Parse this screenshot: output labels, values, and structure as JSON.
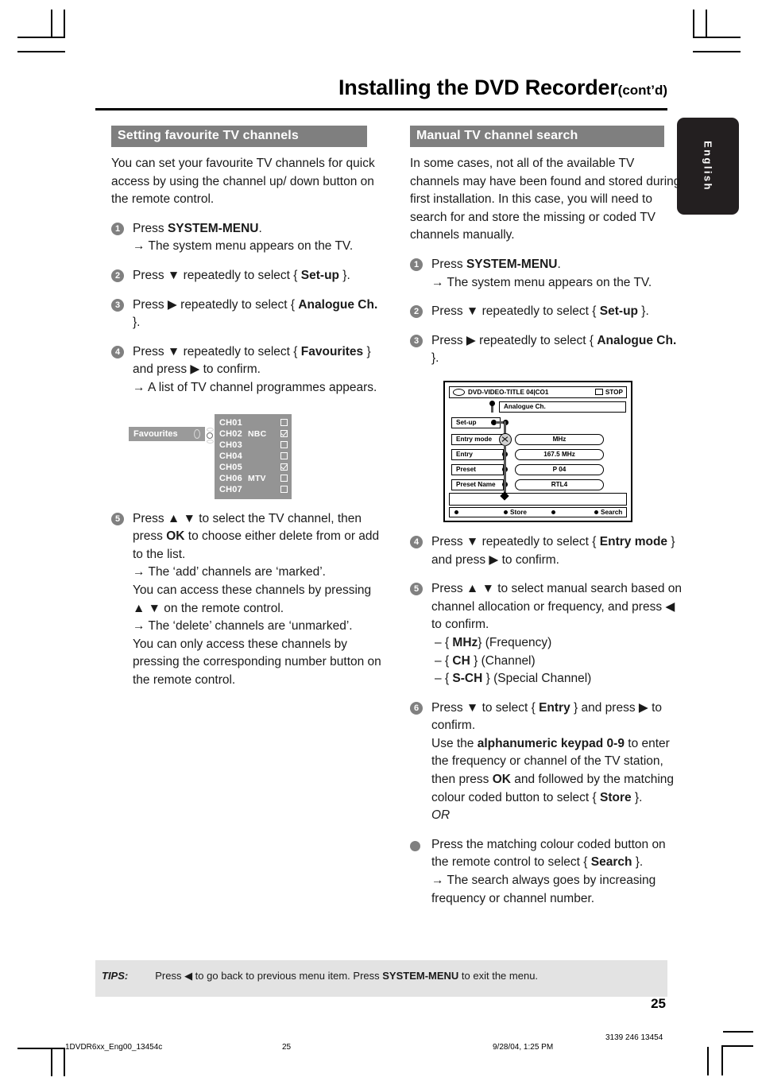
{
  "header": {
    "title": "Installing the DVD Recorder",
    "cont": "(cont’d)"
  },
  "language_tab": {
    "label": "English"
  },
  "left_column": {
    "section_title": "Setting favourite TV channels",
    "intro": "You can set your favourite TV channels for quick access by using the channel up/ down button on the remote control.",
    "steps": [
      {
        "num": "1",
        "line1_pre": "Press ",
        "line1_bold": "SYSTEM-MENU",
        "line1_post": ".",
        "result": "→ The system menu appears on the TV."
      },
      {
        "num": "2",
        "text_pre": "Press ▼ repeatedly to select { ",
        "text_bold": "Set-up",
        "text_post": " }."
      },
      {
        "num": "3",
        "text_pre": "Press ▶ repeatedly to select { ",
        "text_bold": "Analogue Ch.",
        "text_post": " }."
      },
      {
        "num": "4",
        "text_pre": "Press ▼ repeatedly to select { ",
        "text_bold": "Favourites",
        "text_post": " } and press ▶ to confirm.",
        "result": "→ A list of TV channel programmes appears."
      },
      {
        "num": "5",
        "text_pre": "Press ▲ ▼ to select the TV channel, then press ",
        "text_bold": "OK",
        "text_post": " to choose either delete from or add to the list.",
        "result1": "→ The ‘add’ channels are ‘marked’.",
        "result1_more": "You can access these channels by pressing ▲ ▼ on the remote control.",
        "result2": "→ The ‘delete’ channels are ‘unmarked’.",
        "result2_more": "You can only access these channels by pressing the corresponding number button on the remote control."
      }
    ],
    "favourites_mock": {
      "label": "Favourites",
      "rows": [
        {
          "channel": "CH01",
          "network": "",
          "checked": false
        },
        {
          "channel": "CH02",
          "network": "NBC",
          "checked": true
        },
        {
          "channel": "CH03",
          "network": "",
          "checked": false
        },
        {
          "channel": "CH04",
          "network": "",
          "checked": false
        },
        {
          "channel": "CH05",
          "network": "",
          "checked": true
        },
        {
          "channel": "CH06",
          "network": "MTV",
          "checked": false
        },
        {
          "channel": "CH07",
          "network": "",
          "checked": false
        }
      ]
    }
  },
  "right_column": {
    "section_title": "Manual TV channel search",
    "intro": "In some cases, not all of the available TV channels may have been found and stored during first installation. In this case, you will need to search for and store the missing or coded TV channels manually.",
    "steps": [
      {
        "num": "1",
        "line1_pre": "Press ",
        "line1_bold": "SYSTEM-MENU",
        "line1_post": ".",
        "result": "→ The system menu appears on the TV."
      },
      {
        "num": "2",
        "text_pre": "Press ▼ repeatedly to select { ",
        "text_bold": "Set-up",
        "text_post": " }."
      },
      {
        "num": "3",
        "text_pre": "Press ▶ repeatedly to select { ",
        "text_bold": "Analogue Ch.",
        "text_post": " }."
      },
      {
        "num": "4",
        "text_pre": "Press ▼ repeatedly to select { ",
        "text_bold": "Entry mode",
        "text_post": " } and press ▶ to confirm."
      },
      {
        "num": "5",
        "text_plain": "Press ▲ ▼ to select manual search based on channel allocation or frequency, and press ◀ to confirm.",
        "options": [
          {
            "dash": "–",
            "open": "{ ",
            "bold": "MHz",
            "close": "} (Frequency)"
          },
          {
            "dash": "–",
            "open": "{ ",
            "bold": "CH",
            "close": " } (Channel)"
          },
          {
            "dash": "–",
            "open": "{ ",
            "bold": "S-CH",
            "close": " } (Special Channel)"
          }
        ]
      },
      {
        "num": "6",
        "text_pre": "Press ▼ to select { ",
        "text_bold": "Entry",
        "text_post": " } and press ▶ to confirm.",
        "para2_pre": "Use the ",
        "para2_bold": "alphanumeric keypad 0-9",
        "para2_mid": " to enter the frequency or channel of the TV station, then press ",
        "para2_bold2": "OK",
        "para2_mid2": " and followed by the matching colour coded button to select { ",
        "para2_bold3": "Store",
        "para2_post": " }.",
        "or": "OR"
      }
    ],
    "bullet_step": {
      "text_pre": "Press the matching colour coded button on the remote control to select { ",
      "text_bold": "Search",
      "text_post": " }.",
      "result": "→ The search always goes by increasing frequency or channel number."
    },
    "osd_mock": {
      "titlebar_left": "DVD-VIDEO-TITLE 04|CO1",
      "titlebar_right": "STOP",
      "top_field": "Analogue Ch.",
      "setup_label": "Set-up",
      "rows": [
        {
          "label": "Entry mode",
          "value": "MHz"
        },
        {
          "label": "Entry",
          "value": "167.5 MHz"
        },
        {
          "label": "Preset",
          "value": "P 04"
        },
        {
          "label": "Preset Name",
          "value": "RTL4"
        }
      ],
      "footer_store": "Store",
      "footer_search": "Search"
    }
  },
  "tips": {
    "label": "TIPS:",
    "text_pre": "Press ◀ to go back to previous menu item.  Press ",
    "text_bold": "SYSTEM-MENU",
    "text_post": " to exit the menu."
  },
  "page_number": "25",
  "print_footer": {
    "file": "1DVDR6xx_Eng00_13454c",
    "page": "25",
    "date": "9/28/04, 1:25 PM",
    "code": "3139 246 13454"
  },
  "colors": {
    "section_bar": "#7f7f7f",
    "tips_bar": "#e3e3e3",
    "lang_tab": "#231f20",
    "step_num": "#808080",
    "fav_panel": "#949494"
  }
}
